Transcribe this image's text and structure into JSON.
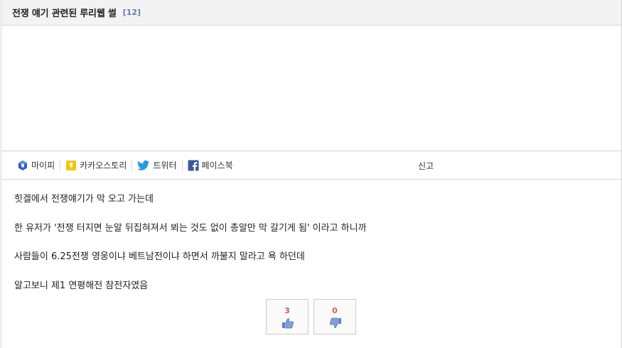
{
  "post": {
    "title": "전쟁 얘기 관련된 루리웹 썰",
    "comment_count": "[12]"
  },
  "share": {
    "mypi_label": "마이피",
    "kakaostory_label": "카카오스토리",
    "twitter_label": "트위터",
    "facebook_label": "페이스북",
    "report_label": "신고"
  },
  "body": {
    "lines": [
      "힛겔에서 전쟁얘기가 막 오고 가는데",
      "한 유저가 '전쟁 터지면 눈알 뒤집혀져서 뵈는 것도 없이 총알만 막 갈기게 됨' 이라고 하니까",
      "사람들이 6.25전쟁 영웅이냐 베트남전이냐 하면서 까불지 말라고 욕 하던데",
      "알고보니 제1 연평해전 참전자였음"
    ]
  },
  "votes": {
    "like_count": "3",
    "dislike_count": "0"
  },
  "colors": {
    "title_bg": "#f3f3f3",
    "comment_count": "#5a7fb0",
    "vote_count": "#d05a5a",
    "mypi_blue": "#2f5fbf",
    "kakao_yellow": "#f7c600",
    "twitter_blue": "#2a9ae0",
    "facebook_blue": "#3b5998"
  }
}
